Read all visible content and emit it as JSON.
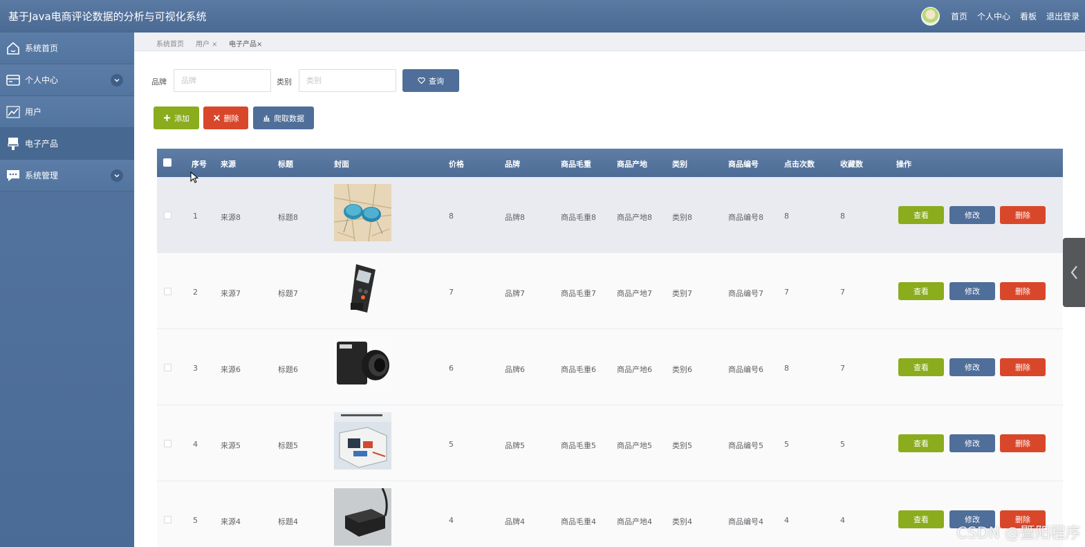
{
  "app": {
    "title": "基于Java电商评论数据的分析与可视化系统"
  },
  "topnav": {
    "links": [
      "首页",
      "个人中心",
      "看板",
      "退出登录"
    ]
  },
  "sidebar": {
    "items": [
      {
        "label": "系统首页",
        "icon": "home-icon",
        "expandable": false
      },
      {
        "label": "个人中心",
        "icon": "card-icon",
        "expandable": true
      },
      {
        "label": "用户",
        "icon": "chart-line-icon",
        "expandable": false
      },
      {
        "label": "电子产品",
        "icon": "brush-icon",
        "expandable": false,
        "active": true
      },
      {
        "label": "系统管理",
        "icon": "chat-icon",
        "expandable": true
      }
    ]
  },
  "breadcrumb_tabs": [
    {
      "label": "系统首页",
      "closable": false
    },
    {
      "label": "用户",
      "closable": true
    },
    {
      "label": "电子产品",
      "closable": true,
      "current": true
    }
  ],
  "search": {
    "brand_label": "品牌",
    "brand_placeholder": "品牌",
    "category_label": "类别",
    "category_placeholder": "类别",
    "query_button": "查询"
  },
  "toolbar": {
    "add_label": "添加",
    "delete_label": "删除",
    "crawl_label": "爬取数据"
  },
  "table": {
    "columns": [
      "序号",
      "来源",
      "标题",
      "封面",
      "价格",
      "品牌",
      "商品毛重",
      "商品产地",
      "类别",
      "商品编号",
      "点击次数",
      "收藏数",
      "操作"
    ],
    "actions": {
      "view": "查看",
      "edit": "修改",
      "delete": "删除"
    },
    "rows": [
      {
        "index": "1",
        "source": "来源8",
        "title": "标题8",
        "cover": "capacitors-image",
        "price": "8",
        "brand": "品牌8",
        "weight": "商品毛重8",
        "origin": "商品产地8",
        "category": "类别8",
        "code": "商品编号8",
        "clicks": "8",
        "favorites": "8"
      },
      {
        "index": "2",
        "source": "来源7",
        "title": "标题7",
        "cover": "meter-device-image",
        "price": "7",
        "brand": "品牌7",
        "weight": "商品毛重7",
        "origin": "商品产地7",
        "category": "类别7",
        "code": "商品编号7",
        "clicks": "7",
        "favorites": "7"
      },
      {
        "index": "3",
        "source": "来源6",
        "title": "标题6",
        "cover": "camera-image",
        "price": "6",
        "brand": "品牌6",
        "weight": "商品毛重6",
        "origin": "商品产地6",
        "category": "类别6",
        "code": "商品编号6",
        "clicks": "8",
        "favorites": "7"
      },
      {
        "index": "4",
        "source": "来源5",
        "title": "标题5",
        "cover": "circuit-box-image",
        "price": "5",
        "brand": "品牌5",
        "weight": "商品毛重5",
        "origin": "商品产地5",
        "category": "类别5",
        "code": "商品编号5",
        "clicks": "5",
        "favorites": "5"
      },
      {
        "index": "5",
        "source": "来源4",
        "title": "标题4",
        "cover": "black-box-image",
        "price": "4",
        "brand": "品牌4",
        "weight": "商品毛重4",
        "origin": "商品产地4",
        "category": "类别4",
        "code": "商品编号4",
        "clicks": "4",
        "favorites": "4"
      }
    ]
  },
  "watermark": "CSDN @暨阳程序",
  "colors": {
    "header": "#4f6f98",
    "sidebar": "#5275a0",
    "primary": "#4f6e99",
    "success": "#8aac1d",
    "danger": "#d9472b"
  }
}
